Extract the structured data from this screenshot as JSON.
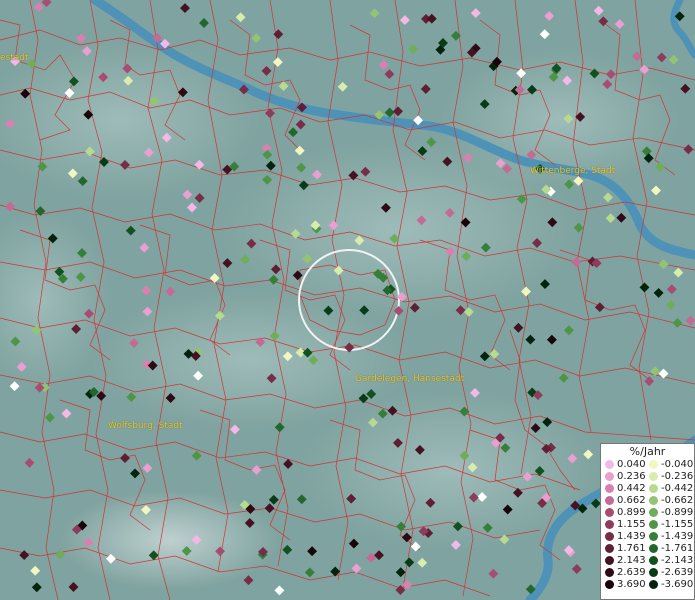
{
  "map": {
    "places": [
      {
        "name": "estadt"
      },
      {
        "name": "Wittenberge, Stadt"
      },
      {
        "name": "Gardelegen, Hansestadt"
      },
      {
        "name": "Wolfsburg, Stadt"
      }
    ]
  },
  "legend": {
    "title": "%/Jahr",
    "positive": [
      {
        "label": "0.040",
        "color": "#f4b8e6"
      },
      {
        "label": "0.236",
        "color": "#e99fd0"
      },
      {
        "label": "0.442",
        "color": "#d980b0"
      },
      {
        "label": "0.662",
        "color": "#c46a95"
      },
      {
        "label": "0.899",
        "color": "#a84d72"
      },
      {
        "label": "1.155",
        "color": "#8e3c5c"
      },
      {
        "label": "1.439",
        "color": "#772c47"
      },
      {
        "label": "1.761",
        "color": "#5e1e34"
      },
      {
        "label": "2.143",
        "color": "#451224"
      },
      {
        "label": "2.639",
        "color": "#2e0a16"
      },
      {
        "label": "3.690",
        "color": "#18040a"
      }
    ],
    "negative": [
      {
        "label": "-0.040",
        "color": "#f2f6c0"
      },
      {
        "label": "-0.236",
        "color": "#d8ecac"
      },
      {
        "label": "-0.442",
        "color": "#b6da8e"
      },
      {
        "label": "-0.662",
        "color": "#92c472"
      },
      {
        "label": "-0.899",
        "color": "#6fad59"
      },
      {
        "label": "-1.155",
        "color": "#4e9546"
      },
      {
        "label": "-1.439",
        "color": "#357f38"
      },
      {
        "label": "-1.761",
        "color": "#22682c"
      },
      {
        "label": "-2.143",
        "color": "#135220"
      },
      {
        "label": "-2.639",
        "color": "#083c16"
      },
      {
        "label": "-3.690",
        "color": "#02240c"
      }
    ]
  },
  "colors": {
    "terrain": "#7fa3a0",
    "river": "#4e92b8",
    "borders": "#d03434",
    "label": "#e2c73a",
    "white_point": "#ffffff"
  }
}
